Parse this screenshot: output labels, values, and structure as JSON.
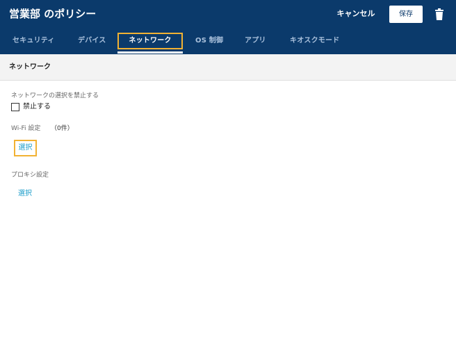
{
  "header": {
    "title": "営業部 のポリシー",
    "cancel_label": "キャンセル",
    "save_label": "保存",
    "delete_icon": "trash-icon"
  },
  "tabs": [
    {
      "label": "セキュリティ",
      "active": false
    },
    {
      "label": "デバイス",
      "active": false
    },
    {
      "label": "ネットワーク",
      "active": true
    },
    {
      "label": "OS 制御",
      "active": false
    },
    {
      "label": "アプリ",
      "active": false
    },
    {
      "label": "キオスクモード",
      "active": false
    }
  ],
  "section": {
    "title": "ネットワーク"
  },
  "network_restriction": {
    "label": "ネットワークの選択を禁止する",
    "checkbox_label": "禁止する",
    "checked": false
  },
  "wifi": {
    "label": "Wi-Fi 設定",
    "count": "（0件）",
    "select_label": "選択"
  },
  "proxy": {
    "label": "プロキシ設定",
    "select_label": "選択"
  },
  "colors": {
    "header_bg": "#0b3a6b",
    "highlight": "#f2b233",
    "link": "#1b9cc9",
    "tab_inactive": "#aac1dc"
  }
}
